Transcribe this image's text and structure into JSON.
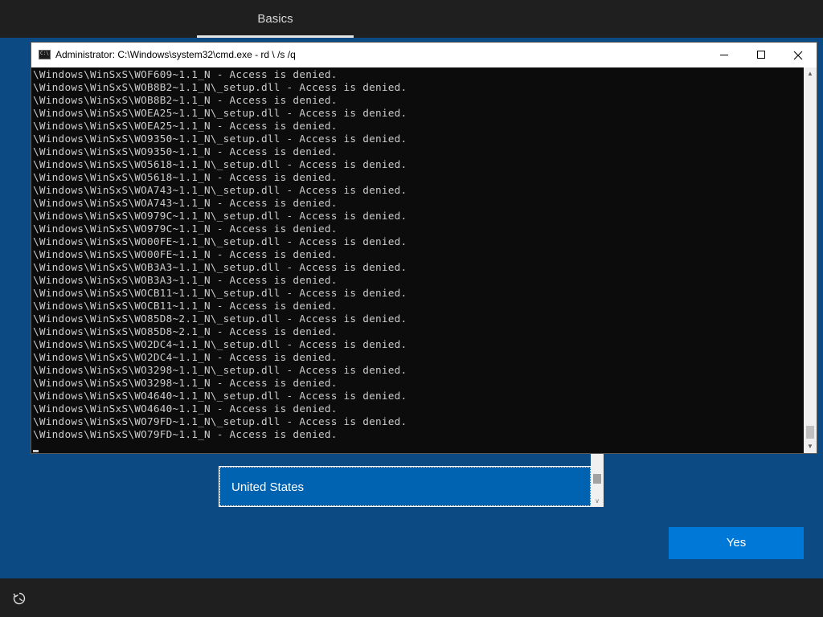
{
  "topbar": {
    "tab_label": "Basics"
  },
  "cmd": {
    "title": "Administrator: C:\\Windows\\system32\\cmd.exe - rd \\ /s /q",
    "lines": [
      "\\Windows\\WinSxS\\WOF609~1.1_N - Access is denied.",
      "\\Windows\\WinSxS\\WOB8B2~1.1_N\\_setup.dll - Access is denied.",
      "\\Windows\\WinSxS\\WOB8B2~1.1_N - Access is denied.",
      "\\Windows\\WinSxS\\WOEA25~1.1_N\\_setup.dll - Access is denied.",
      "\\Windows\\WinSxS\\WOEA25~1.1_N - Access is denied.",
      "\\Windows\\WinSxS\\WO9350~1.1_N\\_setup.dll - Access is denied.",
      "\\Windows\\WinSxS\\WO9350~1.1_N - Access is denied.",
      "\\Windows\\WinSxS\\WO5618~1.1_N\\_setup.dll - Access is denied.",
      "\\Windows\\WinSxS\\WO5618~1.1_N - Access is denied.",
      "\\Windows\\WinSxS\\WOA743~1.1_N\\_setup.dll - Access is denied.",
      "\\Windows\\WinSxS\\WOA743~1.1_N - Access is denied.",
      "\\Windows\\WinSxS\\WO979C~1.1_N\\_setup.dll - Access is denied.",
      "\\Windows\\WinSxS\\WO979C~1.1_N - Access is denied.",
      "\\Windows\\WinSxS\\WO00FE~1.1_N\\_setup.dll - Access is denied.",
      "\\Windows\\WinSxS\\WO00FE~1.1_N - Access is denied.",
      "\\Windows\\WinSxS\\WOB3A3~1.1_N\\_setup.dll - Access is denied.",
      "\\Windows\\WinSxS\\WOB3A3~1.1_N - Access is denied.",
      "\\Windows\\WinSxS\\WOCB11~1.1_N\\_setup.dll - Access is denied.",
      "\\Windows\\WinSxS\\WOCB11~1.1_N - Access is denied.",
      "\\Windows\\WinSxS\\WO85D8~2.1_N\\_setup.dll - Access is denied.",
      "\\Windows\\WinSxS\\WO85D8~2.1_N - Access is denied.",
      "\\Windows\\WinSxS\\WO2DC4~1.1_N\\_setup.dll - Access is denied.",
      "\\Windows\\WinSxS\\WO2DC4~1.1_N - Access is denied.",
      "\\Windows\\WinSxS\\WO3298~1.1_N\\_setup.dll - Access is denied.",
      "\\Windows\\WinSxS\\WO3298~1.1_N - Access is denied.",
      "\\Windows\\WinSxS\\WO4640~1.1_N\\_setup.dll - Access is denied.",
      "\\Windows\\WinSxS\\WO4640~1.1_N - Access is denied.",
      "\\Windows\\WinSxS\\WO79FD~1.1_N\\_setup.dll - Access is denied.",
      "\\Windows\\WinSxS\\WO79FD~1.1_N - Access is denied."
    ]
  },
  "region": {
    "selected_country": "United States"
  },
  "actions": {
    "yes_label": "Yes"
  },
  "icons": {
    "cmd_app": "cmd-app-icon",
    "accessibility": "ease-of-access-icon"
  },
  "colors": {
    "background": "#0b4a82",
    "accent": "#0078d7",
    "selection": "#0063b1",
    "bar": "#1f1f1f"
  }
}
